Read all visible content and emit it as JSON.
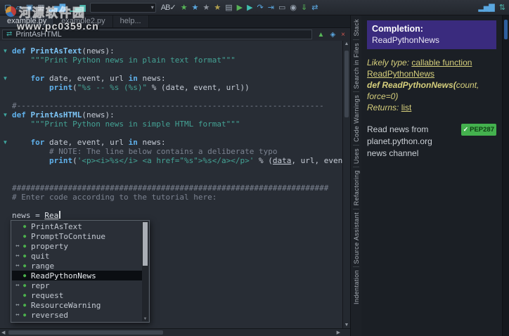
{
  "watermark": {
    "site_name": "河源软件园",
    "site_url": "www.pc0359.cn"
  },
  "toolbar": {
    "icons": [
      {
        "name": "new-file-icon",
        "glyph": "▢",
        "color": "#6fb3e8"
      },
      {
        "name": "open-file-icon",
        "glyph": "▱",
        "color": "#5aa7e0"
      },
      {
        "name": "save-icon",
        "glyph": "▣",
        "color": "#6fb3e8"
      },
      {
        "name": "save-all-icon",
        "glyph": "▦",
        "color": "#9aa5b2"
      },
      {
        "name": "profile-icon",
        "glyph": "▂▅▇",
        "color": "#5aa7e0"
      },
      {
        "name": "chart-icon",
        "glyph": "▁▄▆",
        "color": "#4db6ac"
      }
    ],
    "search": {
      "value": ""
    },
    "icons2": [
      {
        "name": "spellcheck-icon",
        "glyph": "AB✓",
        "color": "#b9c0c9"
      },
      {
        "name": "bookmark-add-icon",
        "glyph": "★",
        "color": "#57b457"
      },
      {
        "name": "bookmark-next-icon",
        "glyph": "★",
        "color": "#5aa7e0"
      },
      {
        "name": "bookmark-prev-icon",
        "glyph": "★",
        "color": "#8d939c"
      },
      {
        "name": "bookmark-clear-icon",
        "glyph": "★",
        "color": "#b3a14e"
      },
      {
        "name": "snippet-icon",
        "glyph": "▤",
        "color": "#9aa5b2"
      },
      {
        "name": "run-icon",
        "glyph": "▶",
        "color": "#57b457"
      },
      {
        "name": "debug-icon",
        "glyph": "▶",
        "color": "#3fbfb0"
      },
      {
        "name": "step-over-icon",
        "glyph": "↷",
        "color": "#5aa7e0"
      },
      {
        "name": "step-into-icon",
        "glyph": "⇥",
        "color": "#5aa7e0"
      },
      {
        "name": "monitor-icon",
        "glyph": "▭",
        "color": "#9aa5b2"
      },
      {
        "name": "search-icon",
        "glyph": "◉",
        "color": "#9aa5b2"
      },
      {
        "name": "download-icon",
        "glyph": "⇓",
        "color": "#57b457"
      },
      {
        "name": "swap-icon",
        "glyph": "⇄",
        "color": "#5aa7e0"
      }
    ],
    "icons_right": [
      {
        "name": "stats-icon",
        "glyph": "▂▅▇",
        "color": "#5aa7e0"
      },
      {
        "name": "sync-icon",
        "glyph": "⇅",
        "color": "#4db6ac"
      }
    ]
  },
  "tabs": [
    {
      "label": "example.py",
      "active": true
    },
    {
      "label": "example2.py",
      "active": false
    },
    {
      "label": "help...",
      "active": false
    }
  ],
  "scope_bar": {
    "value": "PrintAsHTML",
    "symbol_glyph": "⇄",
    "icons": [
      {
        "name": "panel-up-icon",
        "glyph": "▲",
        "color": "#57b457"
      },
      {
        "name": "panel-options-icon",
        "glyph": "◈",
        "color": "#5aa7e0"
      },
      {
        "name": "panel-close-icon",
        "glyph": "×",
        "color": "#c9574f"
      }
    ]
  },
  "editor": {
    "lines": [
      {
        "fold": true,
        "tokens": [
          {
            "c": "kw",
            "t": "def "
          },
          {
            "c": "fn",
            "t": "PrintAsText"
          },
          {
            "c": "txt",
            "t": "(news):"
          }
        ]
      },
      {
        "tokens": [
          {
            "c": "str",
            "t": "    \"\"\"Print Python news in plain text format\"\"\""
          }
        ]
      },
      {
        "tokens": []
      },
      {
        "fold": true,
        "tokens": [
          {
            "c": "txt",
            "t": "    "
          },
          {
            "c": "kw",
            "t": "for"
          },
          {
            "c": "txt",
            "t": " date, event, url "
          },
          {
            "c": "kw",
            "t": "in"
          },
          {
            "c": "txt",
            "t": " news:"
          }
        ]
      },
      {
        "tokens": [
          {
            "c": "txt",
            "t": "        "
          },
          {
            "c": "kw",
            "t": "print"
          },
          {
            "c": "txt",
            "t": "("
          },
          {
            "c": "str",
            "t": "\"%s -- %s (%s)\""
          },
          {
            "c": "txt",
            "t": " % (date, event, url))"
          }
        ]
      },
      {
        "tokens": []
      },
      {
        "tokens": [
          {
            "c": "com",
            "t": "#------------------------------------------------------------------"
          }
        ]
      },
      {
        "fold": true,
        "tokens": [
          {
            "c": "kw",
            "t": "def "
          },
          {
            "c": "fn",
            "t": "PrintAsHTML"
          },
          {
            "c": "txt",
            "t": "(news):"
          }
        ]
      },
      {
        "tokens": [
          {
            "c": "str",
            "t": "    \"\"\"Print Python news in simple HTML format\"\"\""
          }
        ]
      },
      {
        "tokens": []
      },
      {
        "fold": true,
        "tokens": [
          {
            "c": "txt",
            "t": "    "
          },
          {
            "c": "kw",
            "t": "for"
          },
          {
            "c": "txt",
            "t": " date, event, url "
          },
          {
            "c": "kw",
            "t": "in"
          },
          {
            "c": "txt",
            "t": " news:"
          }
        ]
      },
      {
        "tokens": [
          {
            "c": "com",
            "t": "        # NOTE: The line below contains a deliberate typo"
          }
        ]
      },
      {
        "tokens": [
          {
            "c": "txt",
            "t": "        "
          },
          {
            "c": "kw",
            "t": "print"
          },
          {
            "c": "txt",
            "t": "("
          },
          {
            "c": "str",
            "t": "'<p><i>%s</i> <a href=\"%s\">%s</a></p>'"
          },
          {
            "c": "txt",
            "t": " % ("
          },
          {
            "c": "err",
            "t": "data"
          },
          {
            "c": "txt",
            "t": ", url, event))"
          }
        ]
      },
      {
        "tokens": []
      },
      {
        "tokens": []
      },
      {
        "tokens": [
          {
            "c": "com",
            "t": "####################################################################"
          }
        ]
      },
      {
        "tokens": [
          {
            "c": "com",
            "t": "# Enter code according to the tutorial here:"
          }
        ]
      },
      {
        "tokens": []
      },
      {
        "tokens": [
          {
            "c": "txt",
            "t": "news = "
          },
          {
            "c": "cur",
            "t": "Rea"
          },
          {
            "c": "caret",
            "t": ""
          }
        ]
      }
    ]
  },
  "autocomplete": {
    "items": [
      {
        "label": "PrintAsText",
        "icon": "dot",
        "selected": false
      },
      {
        "label": "PromptToContinue",
        "icon": "dot",
        "selected": false
      },
      {
        "label": "property",
        "icon": "arrow-dot",
        "selected": false
      },
      {
        "label": "quit",
        "icon": "arrow-dot",
        "selected": false
      },
      {
        "label": "range",
        "icon": "arrow-dot",
        "selected": false
      },
      {
        "label": "ReadPythonNews",
        "icon": "dot",
        "selected": true
      },
      {
        "label": "repr",
        "icon": "arrow-dot",
        "selected": false
      },
      {
        "label": "request",
        "icon": "dot",
        "selected": false
      },
      {
        "label": "ResourceWarning",
        "icon": "arrow-dot",
        "selected": false
      },
      {
        "label": "reversed",
        "icon": "arrow-dot",
        "selected": false
      }
    ]
  },
  "side_tabs": [
    "Stack",
    "Search in Files",
    "Code Warnings",
    "Uses",
    "Refactoring",
    "Source Assistant",
    "Indentation"
  ],
  "assistant": {
    "completion_label": "Completion:",
    "completion_symbol": "ReadPythonNews",
    "likely_type_label": "Likely type: ",
    "likely_type_link": "callable function",
    "symbol_link": "ReadPythonNews",
    "signature_prefix": "def ReadPythonNews(",
    "signature_args": "count, force=0)",
    "returns_label": "Returns: ",
    "returns_link": "list",
    "doc_line1": "Read news from",
    "doc_line2": "planet.python.org",
    "doc_line3": "news channel",
    "pep_badge": "PEP287",
    "badge_check": "✓"
  }
}
